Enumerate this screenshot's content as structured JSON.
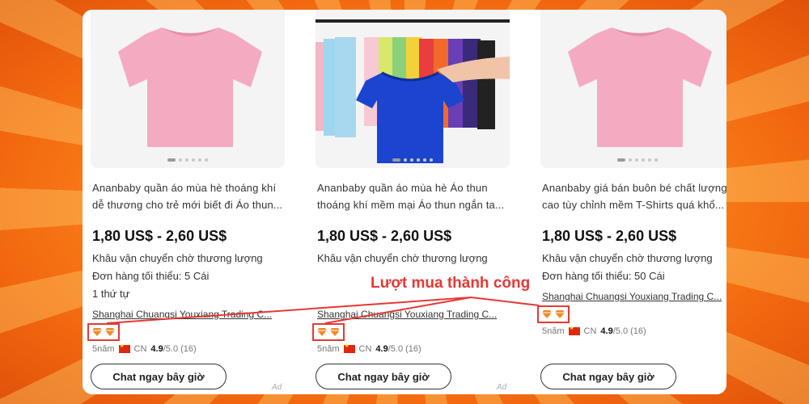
{
  "callout": "Lượt mua thành công",
  "accent_color": "#e53935",
  "products": [
    {
      "image": "pink-tshirt",
      "title_line1": "Ananbaby quần áo mùa hè thoáng khí",
      "title_line2": "dễ thương cho trẻ mới biết đi Áo thun...",
      "price": "1,80 US$ - 2,60 US$",
      "shipping": "Khâu vận chuyển chờ thương lượng",
      "moq": "Đơn hàng tối thiểu: 5 Cái",
      "orders": "1 thứ tự",
      "supplier": "Shanghai Chuangsi Youxiang Trading C...",
      "years": "5năm",
      "country": "CN",
      "rating": "4.9",
      "rating_suffix": "/5.0 (16)",
      "chat_label": "Chat ngay bây giờ",
      "ad_label": "Ad"
    },
    {
      "image": "tshirt-rack",
      "title_line1": "Ananbaby quần áo mùa hè Áo thun",
      "title_line2": "thoáng khí mềm mại Áo thun ngắn ta...",
      "price": "1,80 US$ - 2,60 US$",
      "shipping": "Khâu vận chuyển chờ thương lượng",
      "supplier": "Shanghai Chuangsi Youxiang Trading C...",
      "years": "5năm",
      "country": "CN",
      "rating": "4.9",
      "rating_suffix": "/5.0 (16)",
      "chat_label": "Chat ngay bây giờ",
      "ad_label": "Ad"
    },
    {
      "image": "pink-tshirt",
      "title_line1": "Ananbaby giá bán buôn bé chất lượng",
      "title_line2": "cao tùy chỉnh mềm T-Shirts quá khổ...",
      "price": "1,80 US$ - 2,60 US$",
      "shipping": "Khâu vận chuyển chờ thương lượng",
      "moq": "Đơn hàng tối thiểu: 50 Cái",
      "supplier": "Shanghai Chuangsi Youxiang Trading C...",
      "years": "5năm",
      "country": "CN",
      "rating": "4.9",
      "rating_suffix": "/5.0 (16)",
      "chat_label": "Chat ngay bây giờ"
    }
  ]
}
